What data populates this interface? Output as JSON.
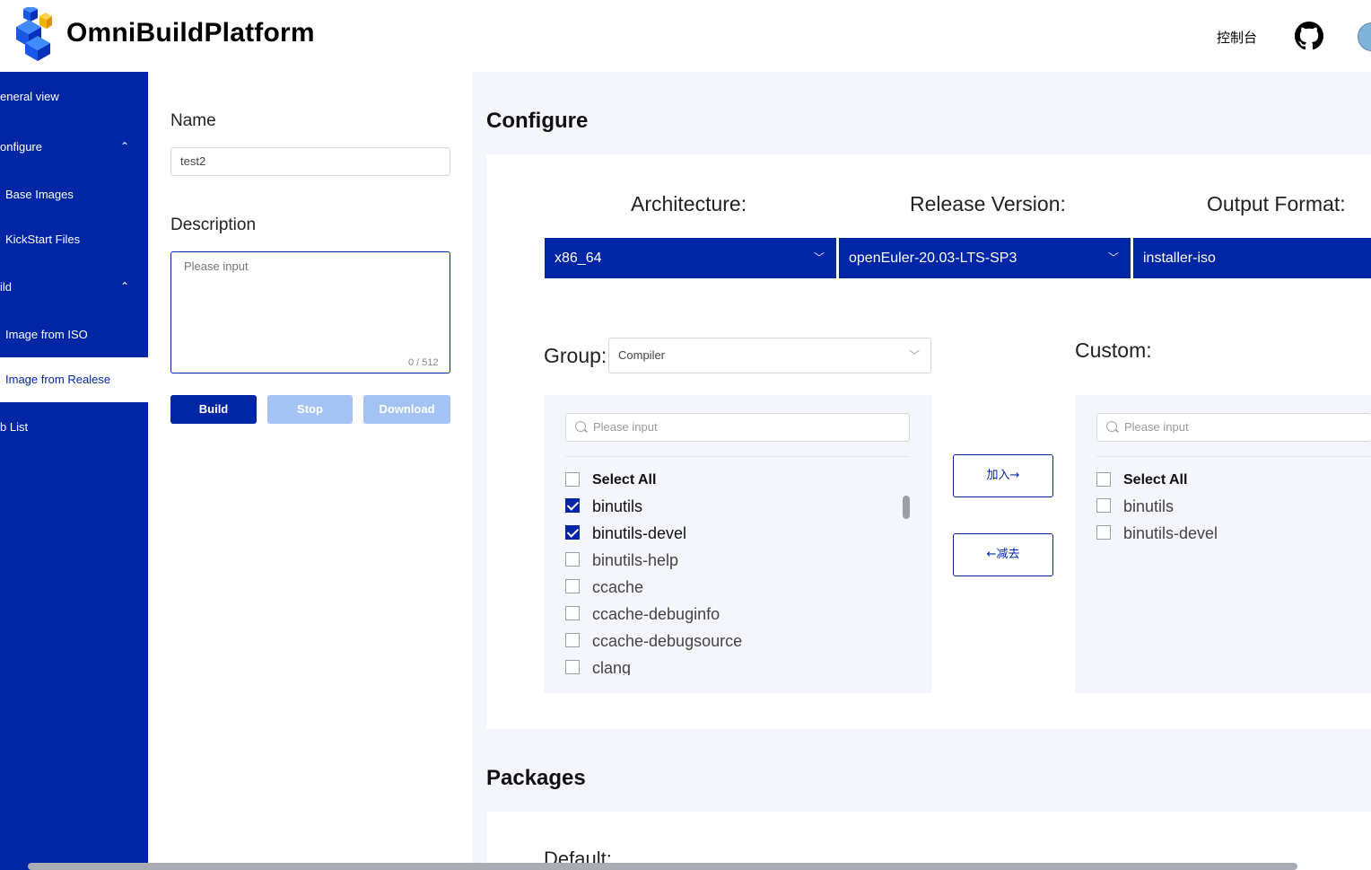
{
  "header": {
    "app_title": "OmniBuildPlatform",
    "console_link": "控制台",
    "icons": [
      "logo-cubes-icon",
      "github-icon",
      "avatar"
    ]
  },
  "sidebar": {
    "items": [
      {
        "label": "eneral view"
      },
      {
        "label": "onfigure"
      },
      {
        "label": "Base Images"
      },
      {
        "label": "KickStart Files"
      },
      {
        "label": "ild"
      },
      {
        "label": "Image from ISO"
      },
      {
        "label": "Image from Realese",
        "active": true
      },
      {
        "label": "b List"
      }
    ],
    "colors": {
      "background": "#0026a5",
      "active_bg": "#ffffff"
    }
  },
  "form": {
    "name_label": "Name",
    "name_value": "test2",
    "description_label": "Description",
    "description_placeholder": "Please input",
    "description_count": "0 / 512",
    "build_label": "Build",
    "stop_label": "Stop",
    "download_label": "Download"
  },
  "configure": {
    "title": "Configure",
    "architecture_label": "Architecture:",
    "architecture_value": "x86_64",
    "release_label": "Release Version:",
    "release_value": "openEuler-20.03-LTS-SP3",
    "output_label": "Output Format:",
    "output_value": "installer-iso",
    "group_label": "Group:",
    "group_value": "Compiler",
    "custom_label": "Custom:",
    "left_panel": {
      "search_placeholder": "Please input",
      "select_all": "Select All",
      "items": [
        {
          "label": "binutils",
          "checked": true
        },
        {
          "label": "binutils-devel",
          "checked": true
        },
        {
          "label": "binutils-help",
          "checked": false
        },
        {
          "label": "ccache",
          "checked": false
        },
        {
          "label": "ccache-debuginfo",
          "checked": false
        },
        {
          "label": "ccache-debugsource",
          "checked": false
        },
        {
          "label": "clang",
          "checked": false
        }
      ]
    },
    "add_button": "加入→",
    "remove_button": "←减去",
    "right_panel": {
      "search_placeholder": "Please input",
      "select_all": "Select All",
      "items": [
        {
          "label": "binutils",
          "checked": false
        },
        {
          "label": "binutils-devel",
          "checked": false
        }
      ]
    }
  },
  "packages": {
    "title": "Packages",
    "default_label": "Default:"
  },
  "colors": {
    "primary": "#0026a5",
    "disabled_button": "#a4c2f4",
    "main_bg": "#f4f6fb"
  }
}
